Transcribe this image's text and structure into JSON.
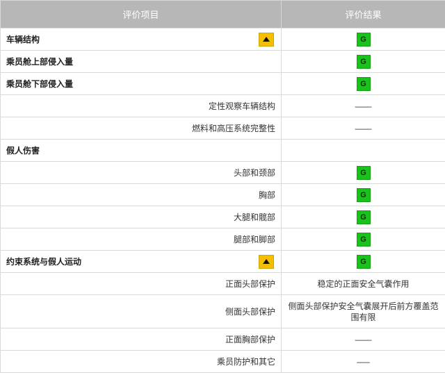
{
  "table": {
    "headers": [
      "评价项目",
      "评价结果"
    ],
    "rows": [
      {
        "label": "车辆结构",
        "level": "main",
        "warning": true,
        "result": "G",
        "result_type": "badge"
      },
      {
        "label": "乘员舱上部侵入量",
        "level": "main",
        "warning": false,
        "result": "G",
        "result_type": "badge"
      },
      {
        "label": "乘员舱下部侵入量",
        "level": "main",
        "warning": false,
        "result": "G",
        "result_type": "badge"
      },
      {
        "label": "定性观察车辆结构",
        "level": "sub",
        "warning": false,
        "result": "——",
        "result_type": "text"
      },
      {
        "label": "燃料和高压系统完整性",
        "level": "sub",
        "warning": false,
        "result": "——",
        "result_type": "text"
      },
      {
        "label": "假人伤害",
        "level": "main",
        "warning": false,
        "result": "",
        "result_type": "empty"
      },
      {
        "label": "头部和颈部",
        "level": "sub",
        "warning": false,
        "result": "G",
        "result_type": "badge"
      },
      {
        "label": "胸部",
        "level": "sub",
        "warning": false,
        "result": "G",
        "result_type": "badge"
      },
      {
        "label": "大腿和髋部",
        "level": "sub",
        "warning": false,
        "result": "G",
        "result_type": "badge"
      },
      {
        "label": "腿部和脚部",
        "level": "sub",
        "warning": false,
        "result": "G",
        "result_type": "badge"
      },
      {
        "label": "约束系统与假人运动",
        "level": "main",
        "warning": true,
        "result": "G",
        "result_type": "badge"
      },
      {
        "label": "正面头部保护",
        "level": "sub",
        "warning": false,
        "result": "稳定的正面安全气囊作用",
        "result_type": "text"
      },
      {
        "label": "侧面头部保护",
        "level": "sub",
        "warning": false,
        "result": "侧面头部保护安全气囊展开后前方覆盖范围有限",
        "result_type": "text",
        "tall": true
      },
      {
        "label": "正面胸部保护",
        "level": "sub",
        "warning": false,
        "result": "——",
        "result_type": "text"
      },
      {
        "label": "乘员防护和其它",
        "level": "sub",
        "warning": false,
        "result": "—–",
        "result_type": "text"
      }
    ]
  },
  "colors": {
    "header_bg": "#b7b7b7",
    "good_badge": "#1cc21c",
    "warning_badge": "#f3c000"
  },
  "icons": {
    "warning": "warning-triangle-icon",
    "good": "good-rating-badge"
  }
}
